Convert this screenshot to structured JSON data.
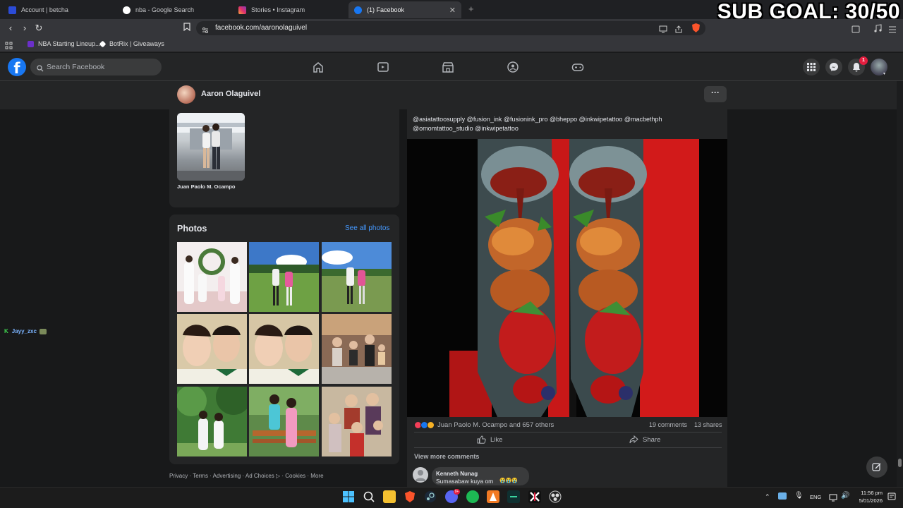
{
  "browser": {
    "tabs": [
      {
        "title": "Account | betcha",
        "icon_color": "#2b4bd6",
        "active": false
      },
      {
        "title": "nba - Google Search",
        "icon_color": "#ffffff",
        "active": false
      },
      {
        "title": "Stories • Instagram",
        "icon_color": "#e1306c",
        "active": false
      },
      {
        "title": "(1) Facebook",
        "icon_color": "#1877f2",
        "active": true
      }
    ],
    "new_tab_label": "+",
    "url": "facebook.com/aaronolaguivel",
    "bookmarks": [
      {
        "label": "NBA Starting Lineup...",
        "icon_color": "#6b2fc9"
      },
      {
        "label": "BotRix | Giveaways",
        "icon_color": "#ffffff"
      }
    ]
  },
  "overlay": {
    "sub_goal": "SUB GOAL: 30/50",
    "chat_user": "Jayy_zxc"
  },
  "facebook": {
    "logo": "f",
    "search_placeholder": "Search Facebook",
    "notifications_badge": "1",
    "profile_name": "Aaron Olaguivel",
    "more_label": "···",
    "friend_name": "Juan Paolo M. Ocampo",
    "photos_title": "Photos",
    "see_all_label": "See all photos",
    "footer": "Privacy · Terms · Advertising · Ad Choices ▷ · Cookies · More",
    "post": {
      "caption": "@asiatattoosupply @fusion_ink @fusionink_pro @bheppo @inkwipetattoo @macbethph @omomtattoo_studio @inkwipetattoo",
      "reactions_text": "Juan Paolo M. Ocampo and 657 others",
      "comments_count": "19 comments",
      "shares_count": "13 shares",
      "like_label": "Like",
      "share_label": "Share",
      "view_more_comments": "View more comments",
      "comment": {
        "author": "Kenneth Nunag",
        "text": "Sumasabaw kuya om",
        "emoji": "😭😭😭"
      }
    }
  },
  "taskbar": {
    "language": "ENG",
    "time": "11:56 pm",
    "date": "5/01/2026"
  },
  "colors": {
    "fb_blue": "#1877f2",
    "link_blue": "#4599ff",
    "background": "#18191a",
    "card": "#242526"
  }
}
